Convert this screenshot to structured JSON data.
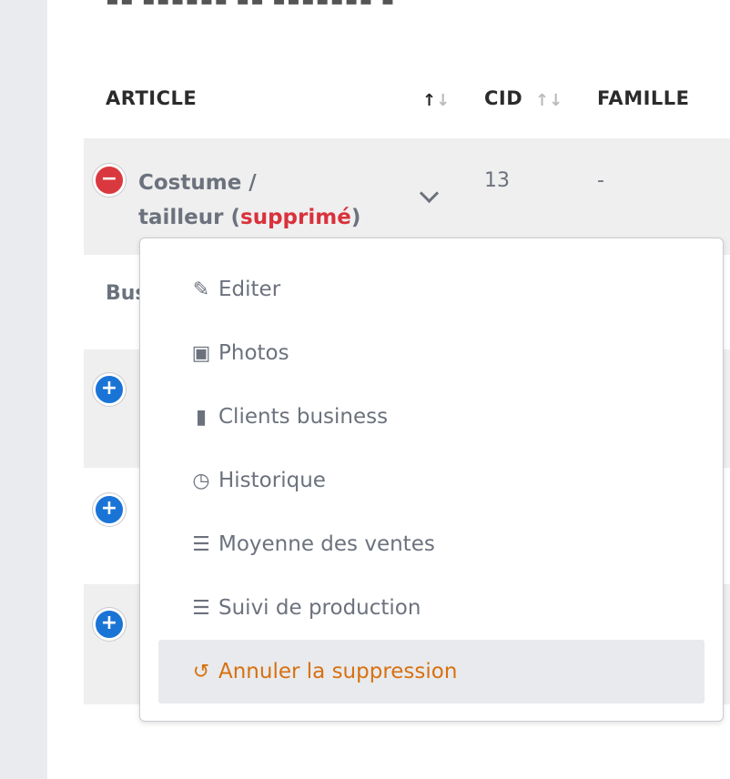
{
  "table": {
    "headers": {
      "article": "ARTICLE",
      "cid": "CID",
      "famille": "FAMILLE"
    },
    "sort_icon": "↑↓",
    "rows": [
      {
        "article_line1": "Costume /",
        "article_line2": "tailleur (",
        "deleted_label": "supprimé",
        "article_close": ")",
        "cid": "13",
        "famille": "-"
      }
    ],
    "section_label": "Bus"
  },
  "menu": {
    "items": [
      {
        "label": "Editer",
        "icon": "edit-icon"
      },
      {
        "label": "Photos",
        "icon": "photos-icon"
      },
      {
        "label": "Clients business",
        "icon": "briefcase-icon"
      },
      {
        "label": "Historique",
        "icon": "clock-icon"
      },
      {
        "label": "Moyenne des ventes",
        "icon": "list-icon"
      },
      {
        "label": "Suivi de production",
        "icon": "list-icon"
      },
      {
        "label": "Annuler la suppression",
        "icon": "undo-icon"
      }
    ]
  },
  "colors": {
    "accent": "#d8700f",
    "danger": "#d8323c",
    "primary": "#1a74d6"
  }
}
